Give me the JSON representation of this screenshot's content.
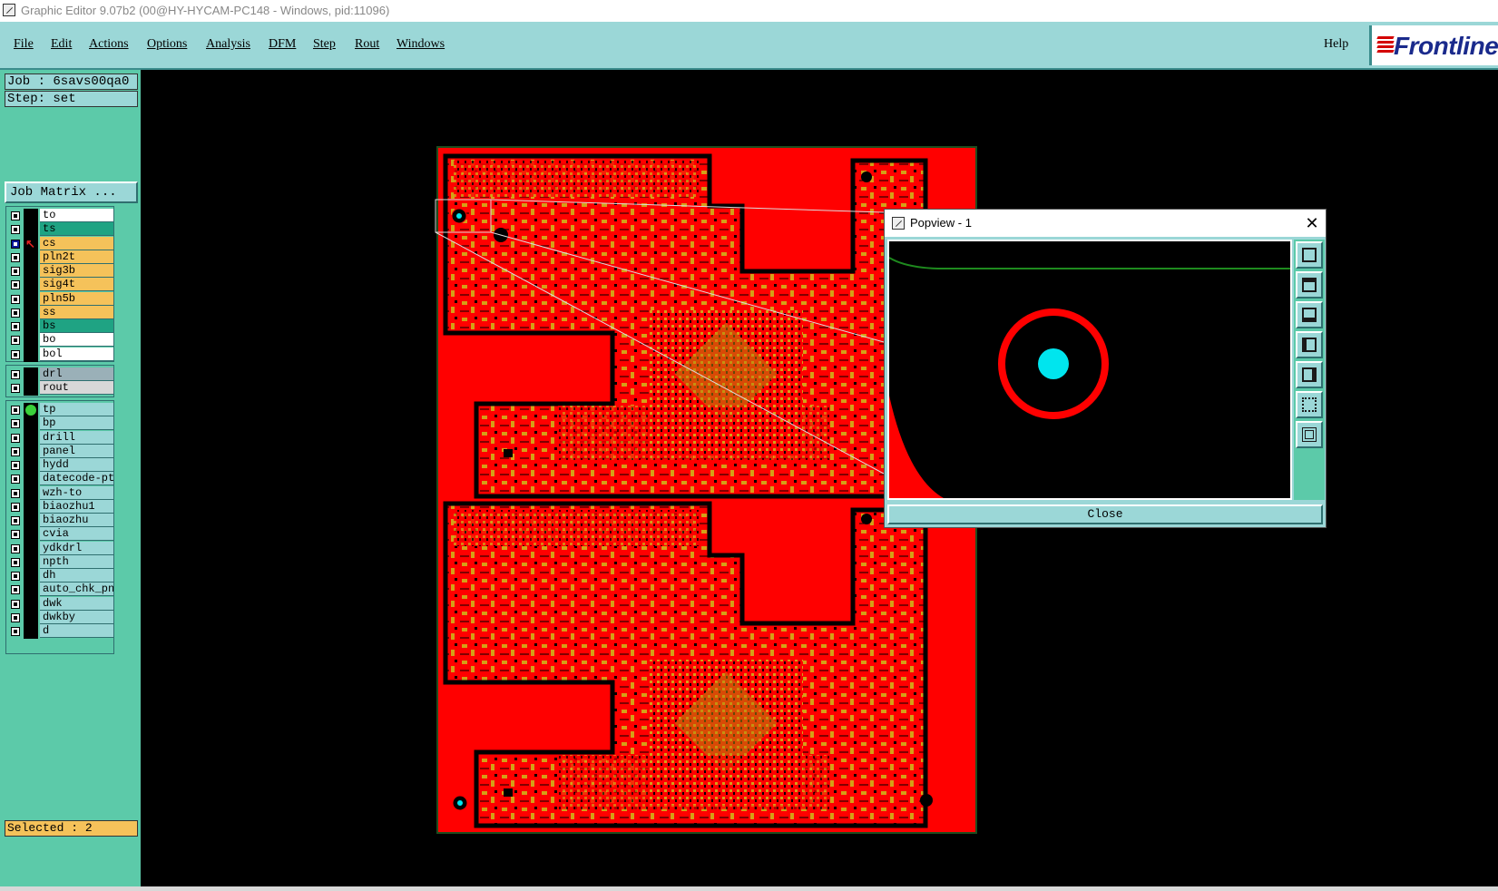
{
  "window": {
    "title": "Graphic Editor 9.07b2 (00@HY-HYCAM-PC148 - Windows, pid:11096)"
  },
  "menu": {
    "items": [
      "File",
      "Edit",
      "Actions",
      "Options",
      "Analysis",
      "DFM",
      "Step",
      "Rout",
      "Windows"
    ],
    "help": "Help",
    "logo": "Frontline"
  },
  "job": {
    "label": "Job : 6savs00qa0",
    "step": "Step: set",
    "matrix_button": "Job Matrix ..."
  },
  "layers": {
    "board": [
      {
        "name": "to",
        "color": "#ffffff"
      },
      {
        "name": "ts",
        "color": "#1fa383"
      },
      {
        "name": "cs",
        "color": "#f5c25a",
        "active": true
      },
      {
        "name": "pln2t",
        "color": "#f5c25a"
      },
      {
        "name": "sig3b",
        "color": "#f5c25a"
      },
      {
        "name": "sig4t",
        "color": "#f5c25a"
      },
      {
        "name": "pln5b",
        "color": "#f5c25a"
      },
      {
        "name": "ss",
        "color": "#f5c25a"
      },
      {
        "name": "bs",
        "color": "#1fa383"
      },
      {
        "name": "bo",
        "color": "#ffffff"
      },
      {
        "name": "bol",
        "color": "#ffffff"
      }
    ],
    "drill": [
      {
        "name": "drl",
        "color": "#9ab0b8"
      },
      {
        "name": "rout",
        "color": "#d8d8d8"
      }
    ],
    "misc": [
      {
        "name": "tp",
        "color": "#9bd7d7",
        "affected": true
      },
      {
        "name": "bp",
        "color": "#9bd7d7"
      },
      {
        "name": "drill",
        "color": "#9bd7d7"
      },
      {
        "name": "panel",
        "color": "#9bd7d7"
      },
      {
        "name": "hydd",
        "color": "#9bd7d7"
      },
      {
        "name": "datecode-pte",
        "color": "#9bd7d7"
      },
      {
        "name": "wzh-to",
        "color": "#9bd7d7"
      },
      {
        "name": "biaozhu1",
        "color": "#9bd7d7"
      },
      {
        "name": "biaozhu",
        "color": "#9bd7d7"
      },
      {
        "name": "cvia",
        "color": "#9bd7d7"
      },
      {
        "name": "ydkdrl",
        "color": "#9bd7d7"
      },
      {
        "name": "npth",
        "color": "#9bd7d7"
      },
      {
        "name": "dh",
        "color": "#9bd7d7"
      },
      {
        "name": "auto_chk_pnl",
        "color": "#9bd7d7"
      },
      {
        "name": "dwk",
        "color": "#9bd7d7"
      },
      {
        "name": "dwkby",
        "color": "#9bd7d7"
      },
      {
        "name": "d",
        "color": "#9bd7d7"
      }
    ]
  },
  "status": {
    "selected": "Selected : 2"
  },
  "popview": {
    "title": "Popview - 1",
    "close_x": "✕",
    "close_button": "Close",
    "tools": [
      "zoom-to-fit-icon",
      "pan-up-icon",
      "pan-down-icon",
      "pan-left-icon",
      "pan-right-icon",
      "zoom-out-icon",
      "zoom-in-icon"
    ]
  },
  "colors": {
    "panel_bg": "#5ccaa9",
    "menu_bg": "#9bd7d7",
    "copper": "#ff0000",
    "component": "#d4a017",
    "drill_hit": "#00e5ee"
  }
}
